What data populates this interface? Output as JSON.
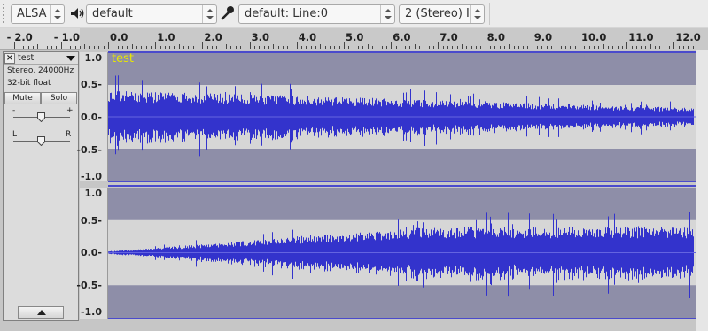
{
  "device_toolbar": {
    "host": "ALSA",
    "playback_device": "default",
    "recording_device": "default: Line:0",
    "channels": "2 (Stereo) I‹",
    "speaker_icon": "speaker-icon",
    "mic_icon": "microphone-icon"
  },
  "ruler": {
    "labels": [
      "- 2.0",
      "- 1.0",
      "0.0",
      "1.0",
      "2.0",
      "3.0",
      "4.0",
      "5.0",
      "6.0",
      "7.0",
      "8.0",
      "9.0",
      "10.0",
      "11.0",
      "12.0"
    ]
  },
  "track": {
    "name": "test",
    "format": "Stereo, 24000Hz",
    "bit_depth": "32-bit float",
    "mute": "Mute",
    "solo": "Solo",
    "gain_minus": "-",
    "gain_plus": "+",
    "pan_left": "L",
    "pan_right": "R",
    "title_overlay": "test"
  },
  "vertical_scale": {
    "labels": [
      "1.0",
      "0.5-",
      "0.0-",
      "-0.5-",
      "-1.0"
    ]
  },
  "colors": {
    "waveform": "#3333cc",
    "waveform_light": "#6464e0",
    "background_dark": "#8e8ea8",
    "background_light": "#d6d6d6",
    "track_title": "#e8e800"
  }
}
